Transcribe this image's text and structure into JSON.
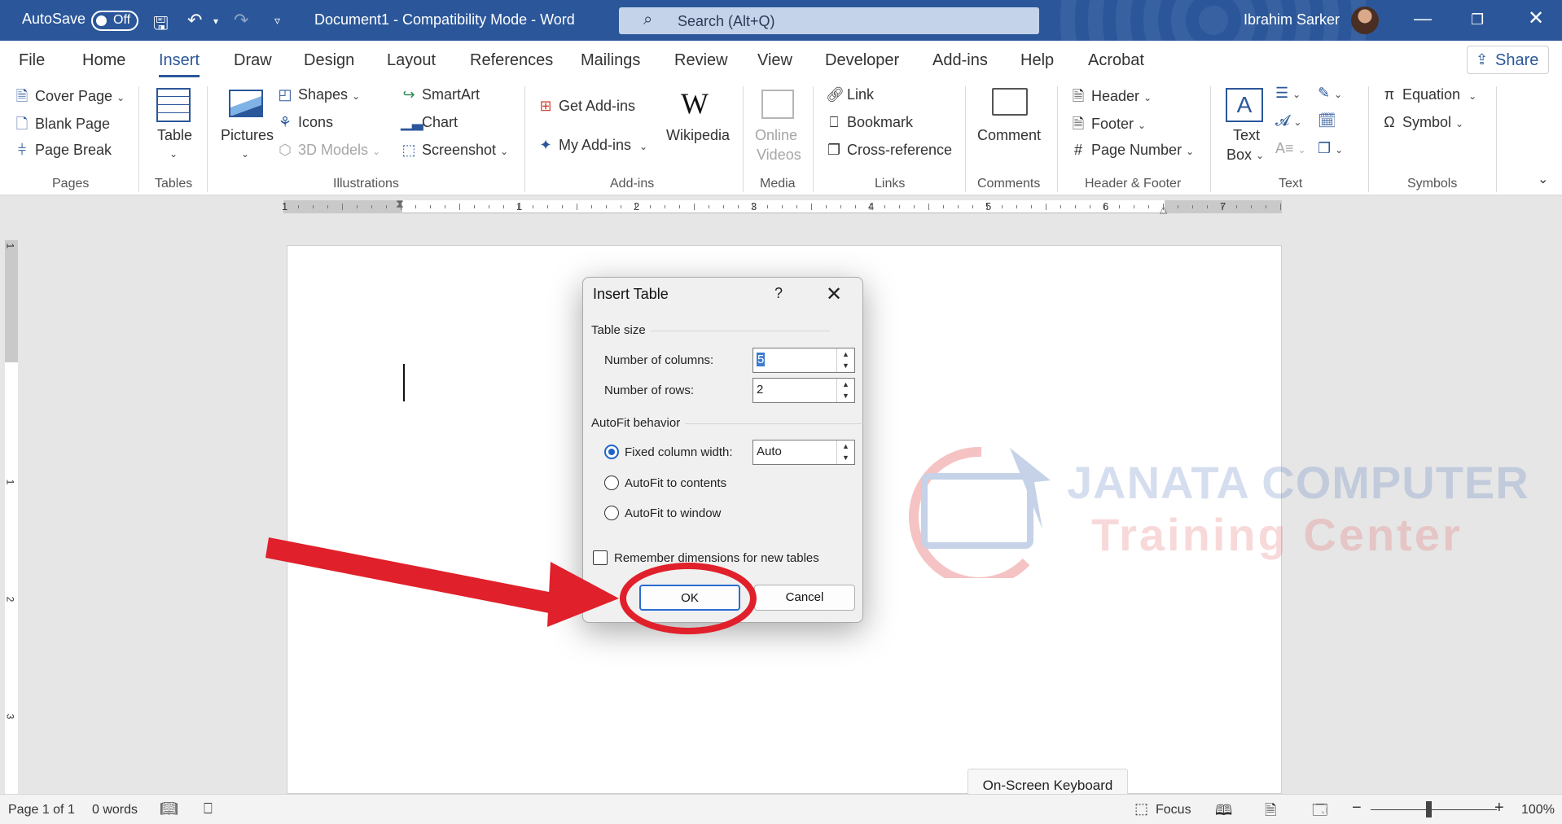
{
  "titlebar": {
    "autosave_label": "AutoSave",
    "autosave_state": "Off",
    "document_title": "Document1  -  Compatibility Mode  -  Word",
    "search_placeholder": "Search (Alt+Q)",
    "user_name": "Ibrahim Sarker"
  },
  "menu": {
    "items": [
      "File",
      "Home",
      "Insert",
      "Draw",
      "Design",
      "Layout",
      "References",
      "Mailings",
      "Review",
      "View",
      "Developer",
      "Add-ins",
      "Help",
      "Acrobat"
    ],
    "active": "Insert",
    "share_label": "Share"
  },
  "ribbon": {
    "pages": {
      "label": "Pages",
      "cover_page": "Cover Page",
      "blank_page": "Blank Page",
      "page_break": "Page Break"
    },
    "tables": {
      "label": "Tables",
      "table": "Table"
    },
    "illustrations": {
      "label": "Illustrations",
      "pictures": "Pictures",
      "shapes": "Shapes",
      "icons": "Icons",
      "models": "3D Models",
      "smartart": "SmartArt",
      "chart": "Chart",
      "screenshot": "Screenshot"
    },
    "addins": {
      "label": "Add-ins",
      "get": "Get Add-ins",
      "my": "My Add-ins",
      "wikipedia": "Wikipedia"
    },
    "media": {
      "label": "Media",
      "online_videos_1": "Online",
      "online_videos_2": "Videos"
    },
    "links": {
      "label": "Links",
      "link": "Link",
      "bookmark": "Bookmark",
      "cross_reference": "Cross-reference"
    },
    "comments": {
      "label": "Comments",
      "comment": "Comment"
    },
    "header_footer": {
      "label": "Header & Footer",
      "header": "Header",
      "footer": "Footer",
      "page_number": "Page Number"
    },
    "text": {
      "label": "Text",
      "text_box_1": "Text",
      "text_box_2": "Box"
    },
    "symbols": {
      "label": "Symbols",
      "equation": "Equation",
      "symbol": "Symbol"
    }
  },
  "ruler": {
    "numbers": [
      "1",
      "1",
      "2",
      "3",
      "4",
      "5",
      "6",
      "7"
    ],
    "vnumbers": [
      "1",
      "1",
      "2",
      "3"
    ]
  },
  "dialog": {
    "title": "Insert Table",
    "help": "?",
    "table_size_label": "Table size",
    "columns_label": "Number of columns:",
    "columns_value": "5",
    "rows_label": "Number of rows:",
    "rows_value": "2",
    "autofit_label": "AutoFit behavior",
    "fixed_label": "Fixed column width:",
    "fixed_value": "Auto",
    "autofit_contents": "AutoFit to contents",
    "autofit_window": "AutoFit to window",
    "selected_option": "fixed",
    "remember_label": "Remember dimensions for new tables",
    "remember_checked": false,
    "ok_label": "OK",
    "cancel_label": "Cancel"
  },
  "watermark": {
    "line1": "JANATA COMPUTER",
    "line2": "Training Center"
  },
  "osk_label": "On-Screen Keyboard",
  "status": {
    "page": "Page 1 of 1",
    "words": "0 words",
    "focus": "Focus",
    "zoom": "100%"
  },
  "colors": {
    "title_bar": "#2b579a",
    "accent": "#2b579a",
    "annotation": "#e0202a"
  }
}
